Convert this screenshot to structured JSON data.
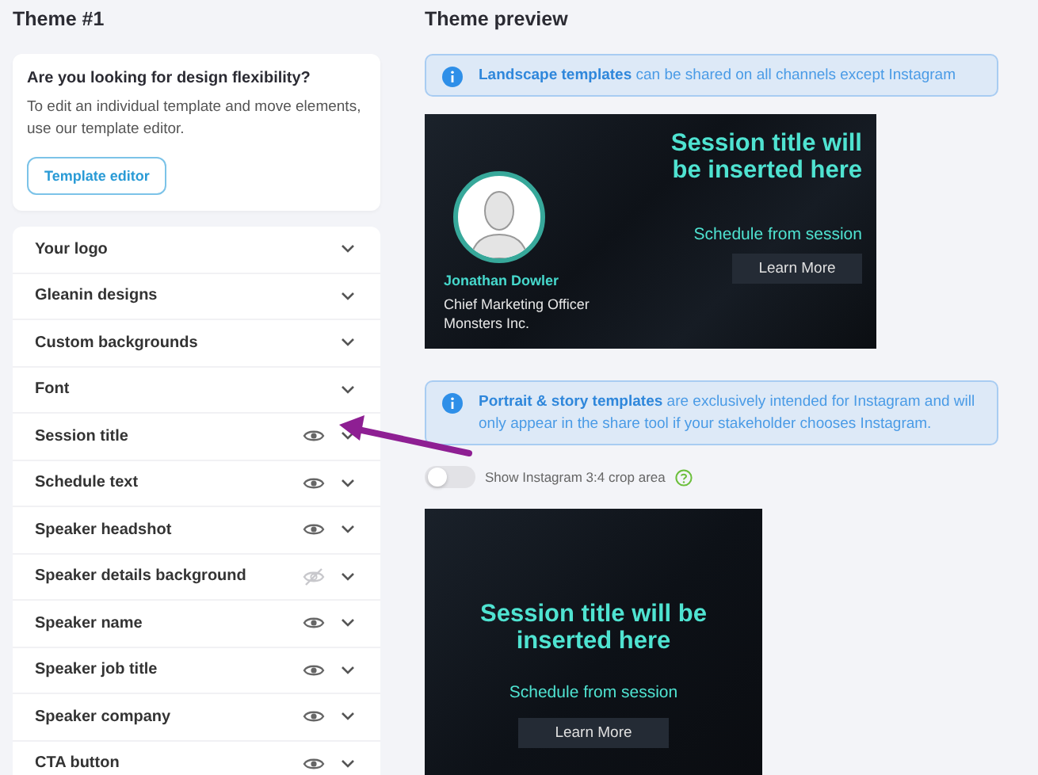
{
  "theme": {
    "title": "Theme #1"
  },
  "flex_card": {
    "heading": "Are you looking for design flexibility?",
    "text": "To edit an individual template and move elements, use our template editor.",
    "button": "Template editor"
  },
  "sections": [
    {
      "label": "Your logo"
    },
    {
      "label": "Gleanin designs"
    },
    {
      "label": "Custom backgrounds"
    },
    {
      "label": "Font"
    },
    {
      "label": "Session title",
      "visible": true
    },
    {
      "label": "Schedule text",
      "visible": true
    },
    {
      "label": "Speaker headshot",
      "visible": true
    },
    {
      "label": "Speaker details background",
      "visible": false
    },
    {
      "label": "Speaker name",
      "visible": true
    },
    {
      "label": "Speaker job title",
      "visible": true
    },
    {
      "label": "Speaker company",
      "visible": true
    },
    {
      "label": "CTA button",
      "visible": true
    }
  ],
  "preview": {
    "title": "Theme preview",
    "landscape_note": "**Landscape templates** can be shared on all channels except Instagram",
    "landscape": {
      "session_title": "Session title will be inserted here",
      "schedule": "Schedule from session",
      "cta": "Learn More",
      "speaker_name": "Jonathan Dowler",
      "job_title": "Chief Marketing Officer",
      "company": "Monsters Inc."
    },
    "portrait_note": "**Portrait & story templates** are exclusively intended for Instagram and will only appear in the share tool if your stakeholder chooses Instagram.",
    "crop_toggle": {
      "label": "Show Instagram 3:4 crop area",
      "on": false
    },
    "portrait": {
      "session_title": "Session title will be inserted here",
      "schedule": "Schedule from session",
      "cta": "Learn More"
    }
  }
}
